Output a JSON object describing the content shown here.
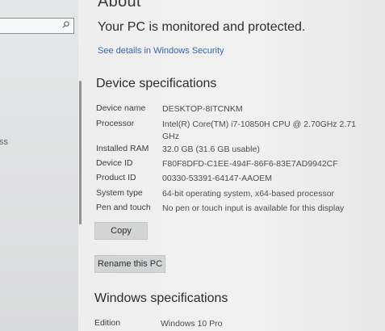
{
  "header": {
    "title": "About",
    "status": "Your PC is monitored and protected.",
    "security_link": "See details in Windows Security"
  },
  "sidebar": {
    "search_placeholder": "",
    "nav_fragment": "ss"
  },
  "device_specs": {
    "heading": "Device specifications",
    "rows": [
      {
        "label": "Device name",
        "value": "DESKTOP-8ITCNKM"
      },
      {
        "label": "Processor",
        "value": "Intel(R) Core(TM) i7-10850H CPU @ 2.70GHz   2.71 GHz"
      },
      {
        "label": "Installed RAM",
        "value": "32.0 GB (31.6 GB usable)"
      },
      {
        "label": "Device ID",
        "value": "F80F8DFD-C1EE-494F-86F6-83E7AD9942CF"
      },
      {
        "label": "Product ID",
        "value": "00330-53391-64147-AAOEM"
      },
      {
        "label": "System type",
        "value": "64-bit operating system, x64-based processor"
      },
      {
        "label": "Pen and touch",
        "value": "No pen or touch input is available for this display"
      }
    ],
    "copy_button": "Copy",
    "rename_button": "Rename this PC"
  },
  "windows_specs": {
    "heading": "Windows specifications",
    "rows": [
      {
        "label": "Edition",
        "value": "Windows 10 Pro"
      }
    ]
  },
  "colors": {
    "link": "#3a64a8",
    "button_bg": "#d3d4d5",
    "page_bg": "#ececec"
  }
}
